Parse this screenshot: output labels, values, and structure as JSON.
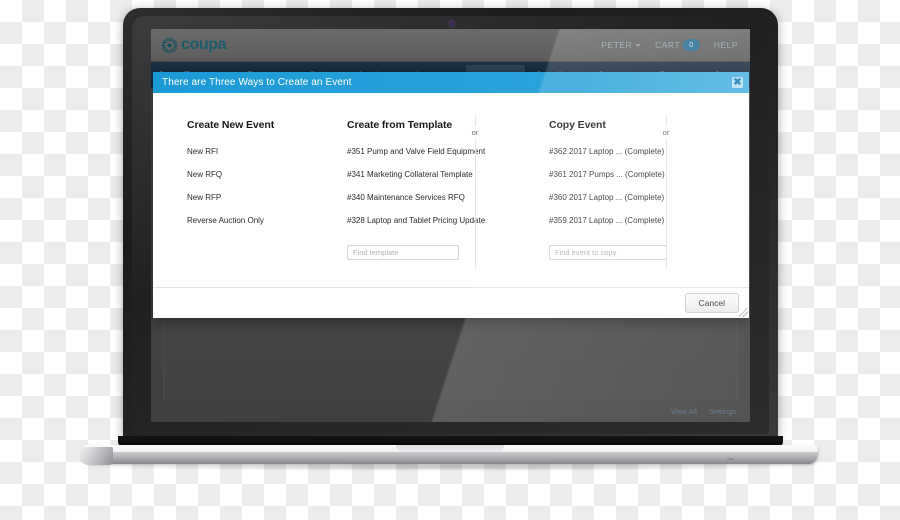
{
  "brand": {
    "logo_text": "coupa",
    "logo_color": "#1d5b6b",
    "accent_color": "#1c9ad6"
  },
  "topbar": {
    "user": "PETER",
    "cart_label": "CART",
    "cart_count": "0",
    "help_label": "HELP"
  },
  "nav": {
    "home_icon": "home-icon",
    "items": [
      {
        "label": "Expenses",
        "active": false
      },
      {
        "label": "Requests",
        "active": false
      },
      {
        "label": "Orders",
        "active": false
      },
      {
        "label": "Invoices",
        "active": false
      },
      {
        "label": "Inventory",
        "active": false
      },
      {
        "label": "Sourcing",
        "active": true
      },
      {
        "label": "Suppliers",
        "active": false
      },
      {
        "label": "Contracts",
        "active": false
      },
      {
        "label": "Reports",
        "active": false
      },
      {
        "label": "Setup",
        "active": false
      }
    ]
  },
  "page": {
    "links": [
      "View All",
      "Settings"
    ]
  },
  "modal": {
    "title": "There are Three Ways to Create an Event",
    "close_icon": "close-icon",
    "separator_label": "or",
    "columns": [
      {
        "title": "Create New Event",
        "items": [
          "New RFI",
          "New RFQ",
          "New RFP",
          "Reverse Auction Only"
        ]
      },
      {
        "title": "Create from Template",
        "items": [
          "#351 Pump and Valve Field Equipment",
          "#341 Marketing Collateral Template",
          "#340 Maintenance Services RFQ",
          "#328 Laptop and Tablet Pricing Update"
        ],
        "search_placeholder": "Find template",
        "search_value": ""
      },
      {
        "title": "Copy Event",
        "items": [
          "#362 2017 Laptop ... (Complete)",
          "#361 2017 Pumps ... (Complete)",
          "#360 2017 Laptop ... (Complete)",
          "#359 2017 Laptop ... (Complete)"
        ],
        "search_placeholder": "Find event to copy",
        "search_value": ""
      }
    ],
    "cancel_label": "Cancel"
  }
}
